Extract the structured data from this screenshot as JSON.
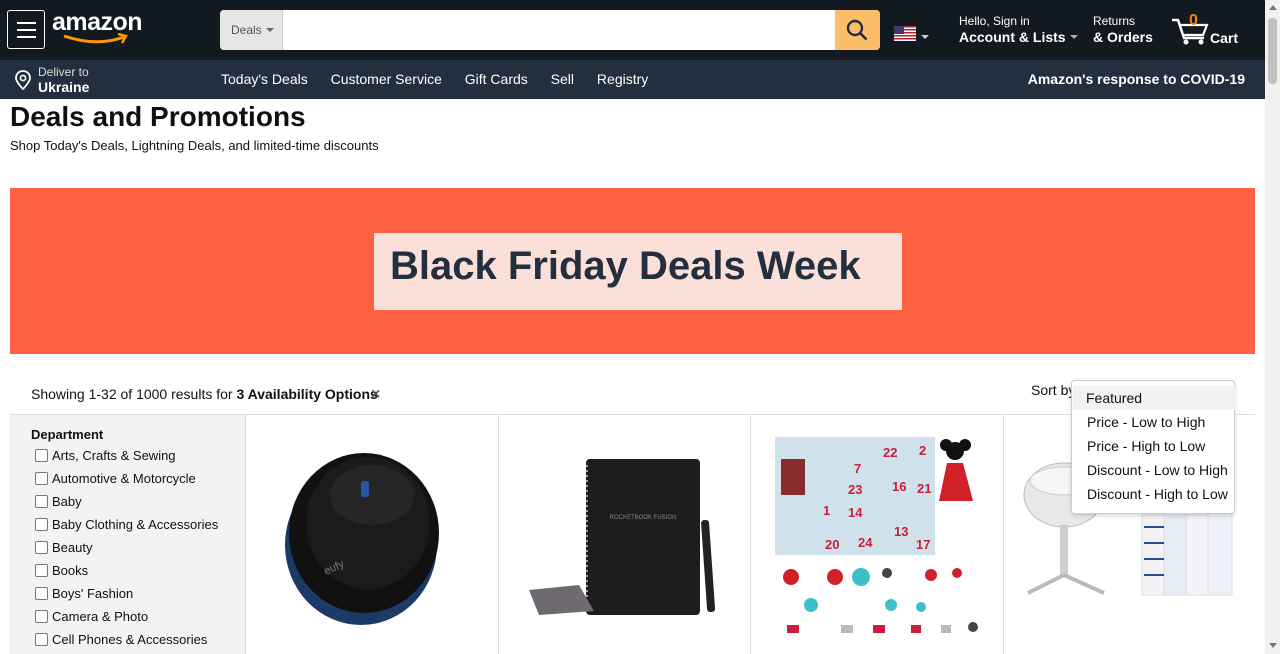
{
  "header": {
    "logo": "amazon",
    "search_dept": "Deals",
    "search_placeholder": "",
    "account_line1": "Hello, Sign in",
    "account_line2": "Account & Lists",
    "orders_line1": "Returns",
    "orders_line2": "& Orders",
    "cart_count": "0",
    "cart_label": "Cart"
  },
  "subnav": {
    "deliver_line1": "Deliver to",
    "deliver_line2": "Ukraine",
    "links": [
      "Today's Deals",
      "Customer Service",
      "Gift Cards",
      "Sell",
      "Registry"
    ],
    "covid": "Amazon's response to COVID-19"
  },
  "page": {
    "title": "Deals and Promotions",
    "subtitle": "Shop Today's Deals, Lightning Deals, and limited-time discounts",
    "banner": "Black Friday Deals Week"
  },
  "results": {
    "prefix": "Showing 1-32 of 1000 results for ",
    "filter": "3 Availability Options",
    "clear": "×"
  },
  "sort": {
    "label": "Sort by",
    "options": [
      "Featured",
      "Price - Low to High",
      "Price - High to Low",
      "Discount - Low to High",
      "Discount - High to Low"
    ],
    "selected": "Featured"
  },
  "department": {
    "title": "Department",
    "items": [
      "Arts, Crafts & Sewing",
      "Automotive & Motorcycle",
      "Baby",
      "Baby Clothing & Accessories",
      "Beauty",
      "Books",
      "Boys' Fashion",
      "Camera & Photo",
      "Cell Phones & Accessories"
    ]
  },
  "products": [
    {
      "name": "robot-vacuum",
      "brand_mark": "eufy"
    },
    {
      "name": "smart-notebook",
      "brand_mark": "ROCKETBOOK FUSION"
    },
    {
      "name": "advent-calendar",
      "numbers": [
        "22",
        "2",
        "7",
        "16",
        "23",
        "1",
        "21",
        "14",
        "13",
        "20",
        "24",
        "17",
        "24"
      ]
    },
    {
      "name": "baby-bassinet"
    }
  ],
  "colors": {
    "nav_bg": "#131921",
    "subnav_bg": "#232f3e",
    "search_button": "#febd69",
    "banner_bg": "#ff6145",
    "banner_box": "#fbe0da",
    "cart_count": "#f08804"
  }
}
